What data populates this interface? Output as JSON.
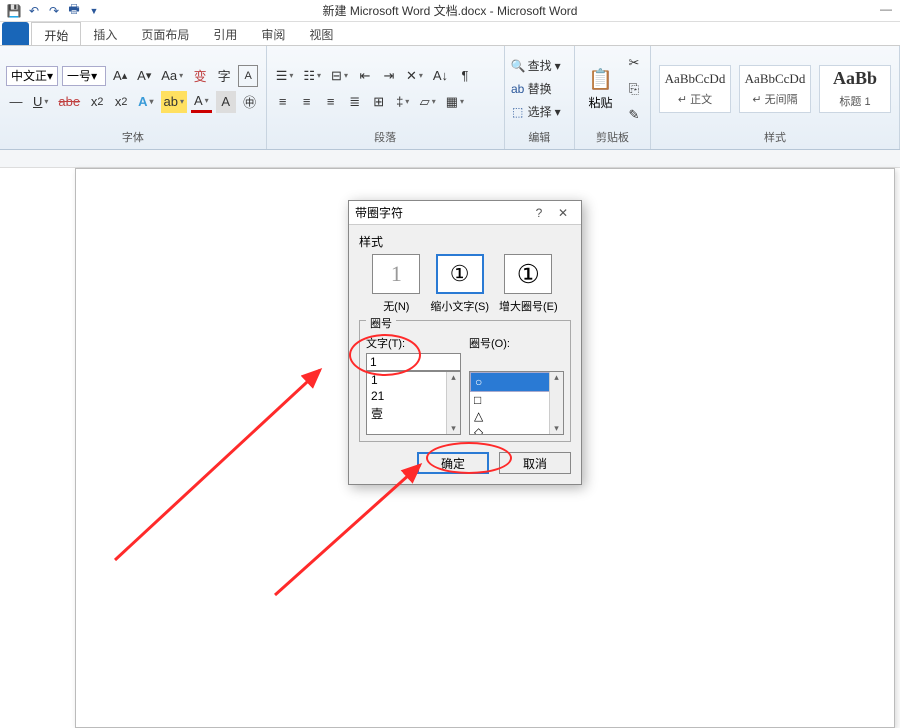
{
  "window": {
    "title": "新建 Microsoft Word 文档.docx - Microsoft Word"
  },
  "tabs": {
    "file": "",
    "items": [
      "开始",
      "插入",
      "页面布局",
      "引用",
      "审阅",
      "视图"
    ],
    "active": "开始"
  },
  "ribbon": {
    "font": {
      "name": "中文正",
      "size": "一号",
      "group_label": "字体"
    },
    "paragraph": {
      "group_label": "段落"
    },
    "editing": {
      "find": "查找",
      "replace": "替换",
      "select": "选择",
      "group_label": "编辑"
    },
    "clipboard": {
      "paste": "粘贴",
      "group_label": "剪贴板"
    },
    "styles": {
      "style1": {
        "preview": "AaBbCcDd",
        "label": "↵ 正文"
      },
      "style2": {
        "preview": "AaBbCcDd",
        "label": "↵ 无间隔"
      },
      "style3": {
        "preview": "AaBb",
        "label": "标题 1"
      },
      "group_label": "样式"
    }
  },
  "dialog": {
    "title": "带圈字符",
    "section_style": "样式",
    "style_none": "无(N)",
    "style_shrink": "缩小文字(S)",
    "style_enlarge": "增大圈号(E)",
    "section_circle": "圈号",
    "text_label": "文字(T):",
    "circle_label": "圈号(O):",
    "text_value": "1",
    "text_list": [
      "1",
      "21",
      "壹"
    ],
    "circle_list": [
      "○",
      "□",
      "△",
      "◇"
    ],
    "ok": "确定",
    "cancel": "取消"
  }
}
